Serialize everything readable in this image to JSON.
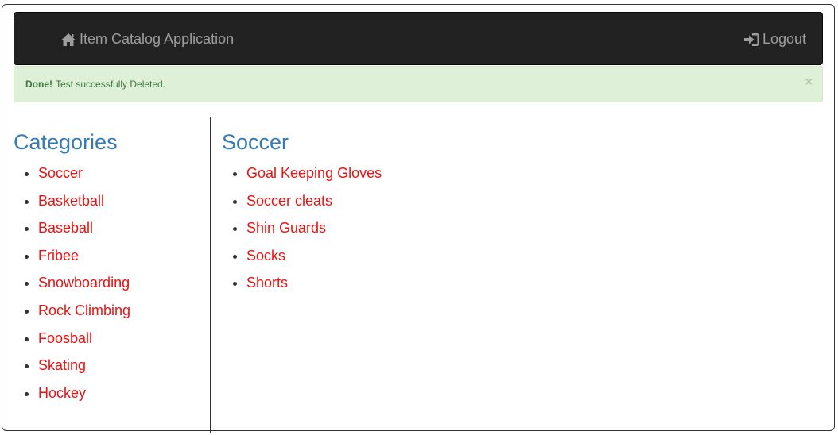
{
  "navbar": {
    "brand_icon": "home-icon",
    "brand": "Item Catalog Application",
    "logout_icon": "log-in-icon",
    "logout": "Logout"
  },
  "alert": {
    "strong": "Done!",
    "message": "Test successfully Deleted.",
    "close": "×"
  },
  "sidebar": {
    "title": "Categories",
    "items": [
      "Soccer",
      "Basketball",
      "Baseball",
      "Fribee",
      "Snowboarding",
      "Rock Climbing",
      "Foosball",
      "Skating",
      "Hockey"
    ]
  },
  "main": {
    "title": "Soccer",
    "items": [
      "Goal Keeping Gloves",
      "Soccer cleats",
      "Shin Guards",
      "Socks",
      "Shorts"
    ]
  },
  "colors": {
    "navbar_bg": "#222222",
    "navbar_text": "#9d9d9d",
    "alert_bg": "#dff0d8",
    "alert_text": "#3c763d",
    "heading": "#337ab7",
    "link": "#ee1111"
  }
}
